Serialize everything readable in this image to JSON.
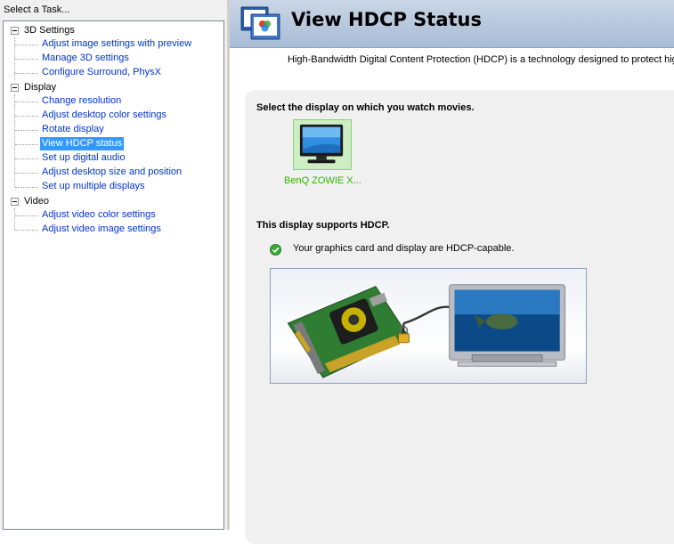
{
  "left_panel": {
    "header": "Select a Task...",
    "categories": [
      {
        "label": "3D Settings",
        "items": [
          "Adjust image settings with preview",
          "Manage 3D settings",
          "Configure Surround, PhysX"
        ]
      },
      {
        "label": "Display",
        "items": [
          "Change resolution",
          "Adjust desktop color settings",
          "Rotate display",
          "View HDCP status",
          "Set up digital audio",
          "Adjust desktop size and position",
          "Set up multiple displays"
        ]
      },
      {
        "label": "Video",
        "items": [
          "Adjust video color settings",
          "Adjust video image settings"
        ]
      }
    ],
    "selected_item": "View HDCP status"
  },
  "page": {
    "title": "View HDCP Status",
    "description": "High-Bandwidth Digital Content Protection (HDCP) is a technology designed to protect high-c",
    "select_heading": "Select the display on which you watch movies.",
    "display_name": "BenQ ZOWIE X...",
    "support_heading": "This display supports HDCP.",
    "capable_text": "Your graphics card and display are HDCP-capable."
  },
  "icons": {
    "banner": "hdcp-display-icon",
    "status": "green-check-icon",
    "monitor": "monitor-icon",
    "lock": "lock-icon"
  },
  "colors": {
    "selection": "#3399ff",
    "link": "#0033cc",
    "display_selected": "#2db200",
    "banner": "#b5c6dc"
  }
}
